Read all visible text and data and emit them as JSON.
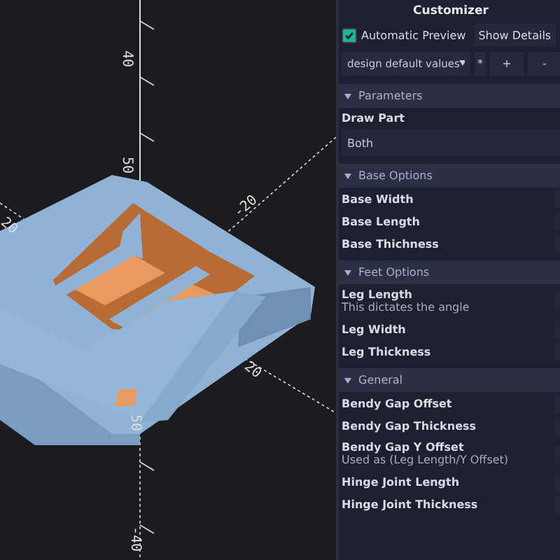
{
  "viewport": {
    "axis_labels": [
      {
        "text": "40"
      },
      {
        "text": "50"
      },
      {
        "text": "-20"
      },
      {
        "text": "20"
      },
      {
        "text": "50"
      },
      {
        "text": "-40"
      },
      {
        "text": "20"
      }
    ]
  },
  "customizer": {
    "title": "Customizer",
    "automatic_preview": {
      "label": "Automatic Preview",
      "checked": true
    },
    "show_details": "Show Details",
    "preset": {
      "value": "design default values",
      "buttons": [
        "*",
        "+",
        "-"
      ]
    },
    "sections": [
      {
        "title": "Parameters",
        "expanded": true,
        "params": [
          {
            "kind": "select",
            "label": "Draw Part",
            "value": "Both"
          }
        ]
      },
      {
        "title": "Base Options",
        "expanded": true,
        "params": [
          {
            "kind": "number",
            "label": "Base Width"
          },
          {
            "kind": "number",
            "label": "Base Length"
          },
          {
            "kind": "number",
            "label": "Base Thichness"
          }
        ]
      },
      {
        "title": "Feet Options",
        "expanded": true,
        "params": [
          {
            "kind": "number",
            "label": "Leg Length",
            "description": "This dictates the angle"
          },
          {
            "kind": "number",
            "label": "Leg Width"
          },
          {
            "kind": "number",
            "label": "Leg Thickness"
          }
        ]
      },
      {
        "title": "General",
        "expanded": true,
        "params": [
          {
            "kind": "number",
            "label": "Bendy Gap Offset"
          },
          {
            "kind": "number",
            "label": "Bendy Gap Thickness"
          },
          {
            "kind": "number",
            "label": "Bendy Gap Y Offset",
            "description": "Used as (Leg Length/Y Offset)"
          },
          {
            "kind": "number",
            "label": "Hinge Joint Length"
          },
          {
            "kind": "number",
            "label": "Hinge Joint Thickness"
          }
        ]
      }
    ]
  }
}
